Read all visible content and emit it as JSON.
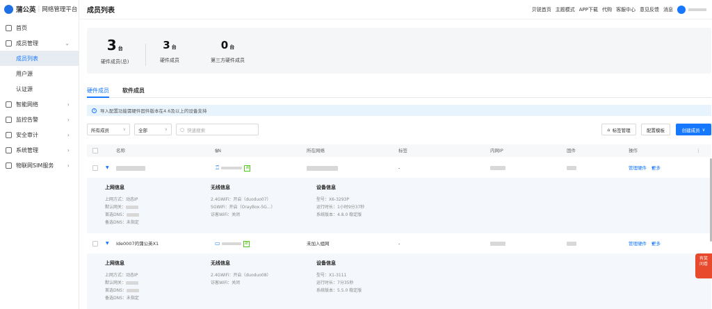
{
  "app": {
    "brand": "蒲公英",
    "platform": "网络管理平台"
  },
  "sidebar": {
    "items": [
      {
        "label": "首页",
        "icon": "home-icon"
      },
      {
        "label": "成员管理",
        "icon": "user-icon"
      },
      {
        "label": "成员列表",
        "sub": true,
        "active": true
      },
      {
        "label": "用户源",
        "sub": true
      },
      {
        "label": "认证源",
        "sub": true
      },
      {
        "label": "智能网络",
        "icon": "network-icon"
      },
      {
        "label": "监控告警",
        "icon": "monitor-icon"
      },
      {
        "label": "安全审计",
        "icon": "audit-icon"
      },
      {
        "label": "系统管理",
        "icon": "settings-icon"
      },
      {
        "label": "物联网SIM服务",
        "icon": "sim-icon"
      }
    ]
  },
  "header": {
    "title": "成员列表",
    "links": [
      "贝锐首页",
      "主题模式",
      "APP下载",
      "代购",
      "客服中心",
      "意见反馈",
      "消息"
    ]
  },
  "stats": {
    "items": [
      {
        "value": "3",
        "unit": "台",
        "label": "硬件成员(总)"
      },
      {
        "value": "3",
        "unit": "台",
        "label": "硬件成员"
      },
      {
        "value": "0",
        "unit": "台",
        "label": "第三方硬件成员"
      }
    ]
  },
  "tabs": {
    "hardware": "硬件成员",
    "software": "软件成员"
  },
  "notice": "导入配置功能需硬件固件版本在4.6及以上的设备支持",
  "filters": {
    "members": "所有成员",
    "status": "全部",
    "search_placeholder": "快速搜索",
    "tag_btn": "标签管理",
    "template_btn": "配置模板",
    "create_btn": "创建成员"
  },
  "table": {
    "headers": {
      "name": "名称",
      "sn": "SN",
      "network": "所在网络",
      "tag": "标签",
      "ip": "内网IP",
      "firmware": "固件",
      "action": "操作"
    },
    "rows": [
      {
        "name": "",
        "network": "",
        "tag": "-",
        "new": "新",
        "manage": "管理硬件",
        "more": "更多",
        "detail": {
          "net_h": "上网信息",
          "net": [
            "上网方式：动态IP",
            "默认网关：",
            "首选DNS：",
            "备选DNS：未指定"
          ],
          "wifi_h": "无线信息",
          "wifi": [
            "2.4GWiFi：开启（duoduo07）",
            "5GWiFi：开启（OrayBox-5G...）",
            "访客WiFi：关闭"
          ],
          "dev_h": "设备信息",
          "dev": [
            "型号：X6-3293P",
            "运行时长：1小时9分37秒",
            "系统版本：4.8.0 稳定版"
          ]
        }
      },
      {
        "name": "Ide0007的蒲公英X1",
        "network": "未加入组网",
        "tag": "-",
        "new": "新",
        "manage": "管理硬件",
        "more": "更多",
        "detail": {
          "net_h": "上网信息",
          "net": [
            "上网方式：动态IP",
            "默认网关：",
            "首选DNS：",
            "备选DNS：未指定"
          ],
          "wifi_h": "无线信息",
          "wifi": [
            "2.4GWiFi：开启（duoduo08）",
            "访客WiFi：关闭"
          ],
          "dev_h": "设备信息",
          "dev": [
            "型号：X1-3111",
            "运行时长：7分35秒",
            "系统版本：5.5.0 稳定版"
          ]
        }
      }
    ]
  },
  "float_ad": {
    "line1": "有奖",
    "line2": "问卷"
  }
}
